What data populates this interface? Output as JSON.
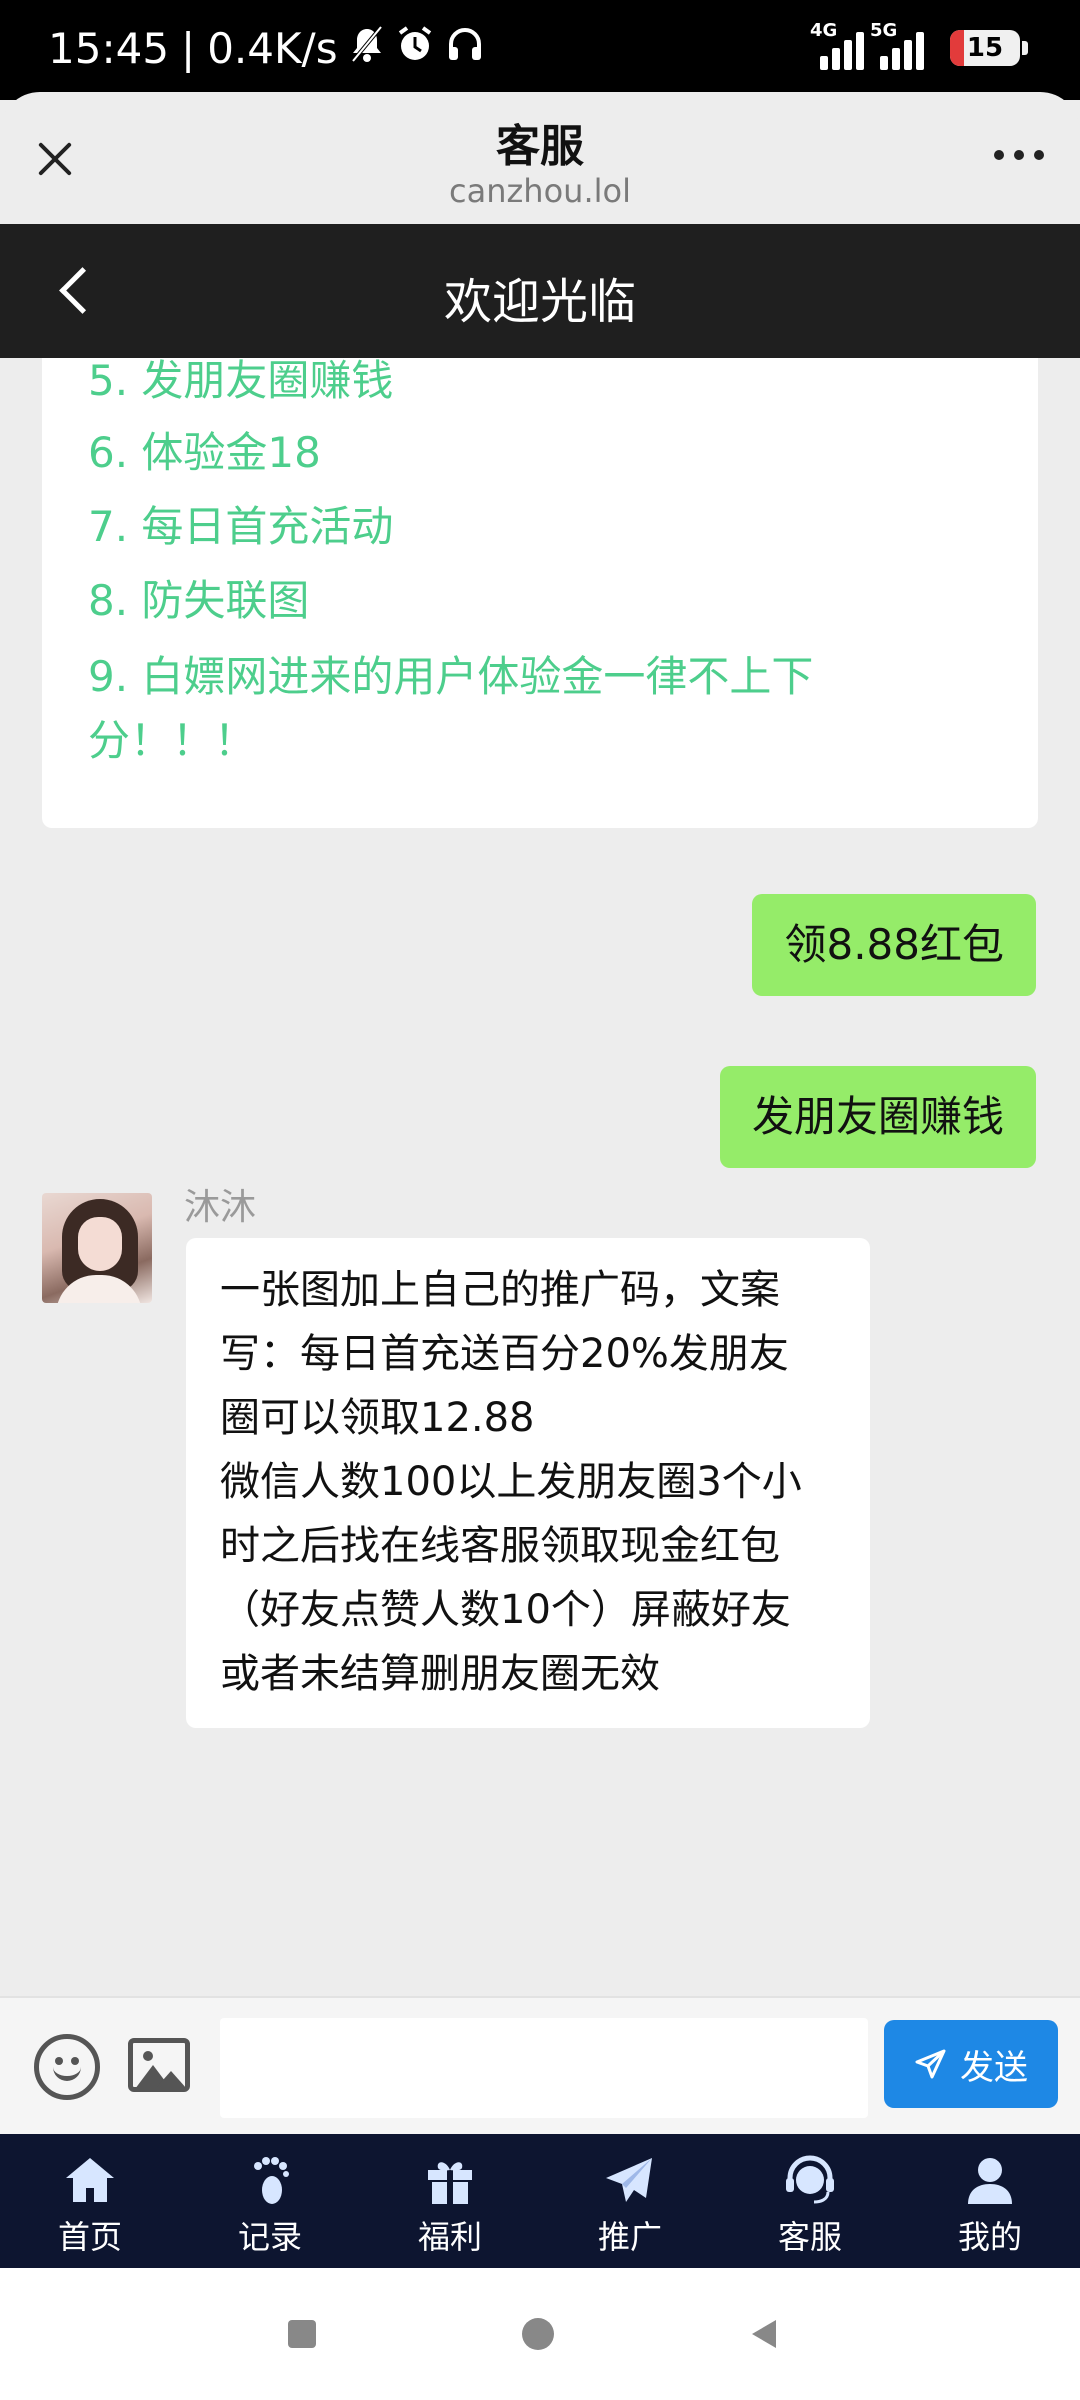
{
  "status_bar": {
    "time": "15:45",
    "separator": "|",
    "speed": "0.4K/s",
    "network1": "4G",
    "network2": "5G",
    "battery": "15"
  },
  "browser": {
    "title": "客服",
    "url": "canzhou.lol"
  },
  "page": {
    "title": "欢迎光临"
  },
  "info_card": {
    "lines": [
      "5. 发朋友圈赚钱",
      "6. 体验金18",
      "7. 每日首充活动",
      "8. 防失联图",
      "9. 白嫖网进来的用户体验金一律不上下",
      "分！！！"
    ]
  },
  "messages": {
    "sent1": "领8.88红包",
    "sent2": "发朋友圈赚钱",
    "sender_name": "沐沐",
    "reply_lines": [
      "一张图加上自己的推广码，文案",
      "写：每日首充送百分20%发朋友",
      "圈可以领取12.88",
      "微信人数100以上发朋友圈3个小",
      "时之后找在线客服领取现金红包",
      "（好友点赞人数10个）屏蔽好友",
      "或者未结算删朋友圈无效"
    ]
  },
  "input": {
    "placeholder": "",
    "value": "",
    "send_label": "发送"
  },
  "tabs": [
    {
      "label": "首页",
      "icon": "home-icon"
    },
    {
      "label": "记录",
      "icon": "footprint-icon"
    },
    {
      "label": "福利",
      "icon": "gift-icon"
    },
    {
      "label": "推广",
      "icon": "paper-plane-icon"
    },
    {
      "label": "客服",
      "icon": "headset-icon"
    },
    {
      "label": "我的",
      "icon": "user-icon"
    }
  ],
  "colors": {
    "accent_green_text": "#4dce8c",
    "sent_bubble": "#95ec69",
    "send_button": "#1e88e5",
    "tab_bar": "#0d1530"
  }
}
